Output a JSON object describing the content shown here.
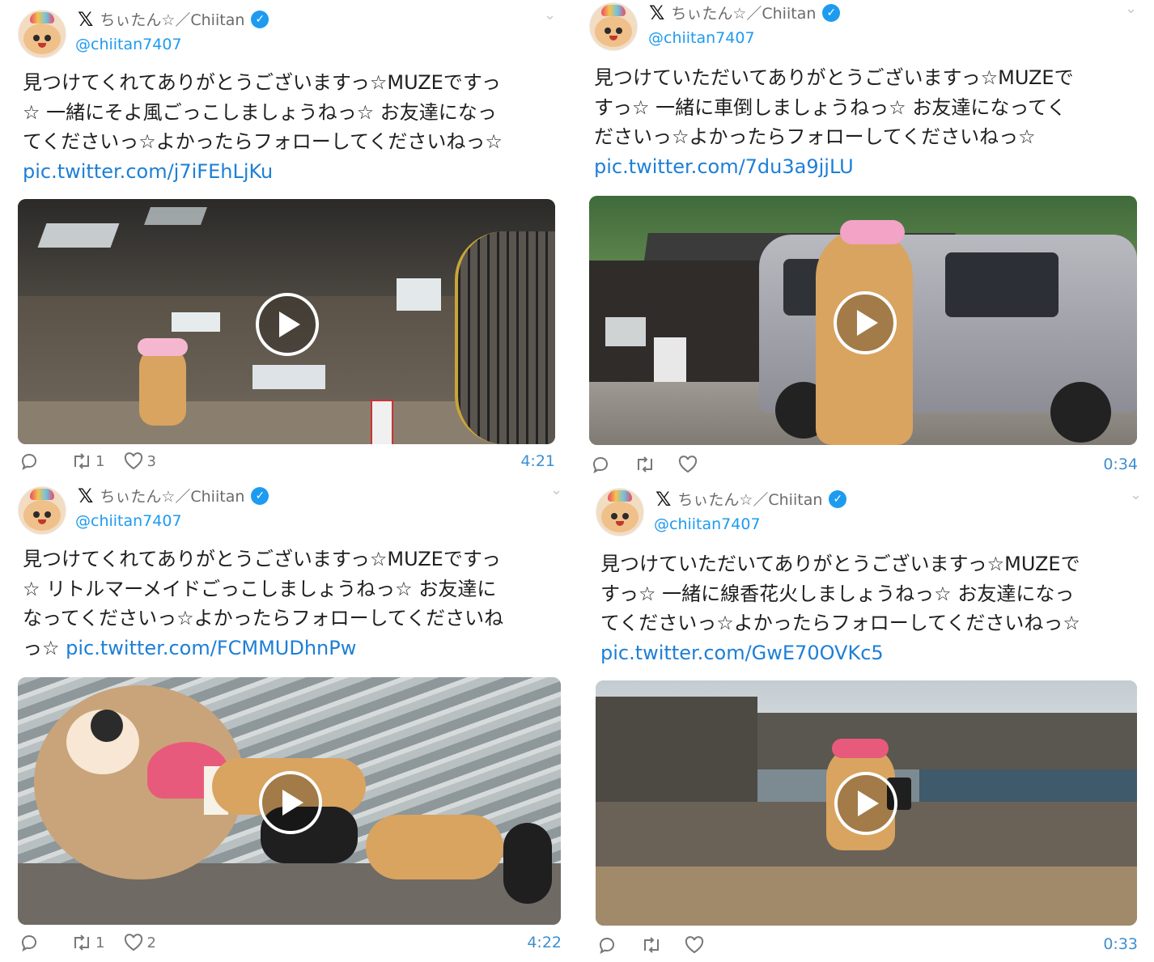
{
  "tweets": [
    {
      "display_name": "ちぃたん☆／Chiitan",
      "handle": "@chiitan7407",
      "body_lines": [
        "見つけてくれてありがとうございますっ☆MUZEですっ",
        "☆ 一緒にそよ風ごっこしましょうねっ☆ お友達になっ",
        "てくださいっ☆よかったらフォローしてくださいねっ☆"
      ],
      "link": "pic.twitter.com/j7iFEhLjKu",
      "retweets": "1",
      "likes": "3",
      "duration": "4:21"
    },
    {
      "display_name": "ちぃたん☆／Chiitan",
      "handle": "@chiitan7407",
      "body_lines": [
        "見つけていただいてありがとうございますっ☆MUZEで",
        "すっ☆ 一緒に車倒しましょうねっ☆ お友達になってく",
        "ださいっ☆よかったらフォローしてくださいねっ☆"
      ],
      "link": "pic.twitter.com/7du3a9jjLU",
      "retweets": "",
      "likes": "",
      "duration": "0:34"
    },
    {
      "display_name": "ちぃたん☆／Chiitan",
      "handle": "@chiitan7407",
      "body_lines": [
        "見つけてくれてありがとうございますっ☆MUZEですっ",
        "☆ リトルマーメイドごっこしましょうねっ☆ お友達に",
        "なってくださいっ☆よかったらフォローしてくださいね"
      ],
      "last_line_prefix": "っ☆ ",
      "link": "pic.twitter.com/FCMMUDhnPw",
      "retweets": "1",
      "likes": "2",
      "duration": "4:22"
    },
    {
      "display_name": "ちぃたん☆／Chiitan",
      "handle": "@chiitan7407",
      "body_lines": [
        "見つけていただいてありがとうございますっ☆MUZEで",
        "すっ☆ 一緒に線香花火しましょうねっ☆ お友達になっ",
        "てくださいっ☆よかったらフォローしてくださいねっ☆"
      ],
      "link": "pic.twitter.com/GwE70OVKc5",
      "retweets": "",
      "likes": "",
      "duration": "0:33"
    }
  ],
  "icons": {
    "logo": "x-logo-icon",
    "verified": "verified-badge-icon",
    "reply": "reply-icon",
    "retweet": "retweet-icon",
    "like": "heart-icon",
    "menu": "chevron-down-icon",
    "play": "play-icon"
  },
  "colors": {
    "link": "#1d7fd6",
    "handle": "#1d9bf0",
    "verified": "#1d9bf0",
    "duration": "#3f8fcf"
  }
}
